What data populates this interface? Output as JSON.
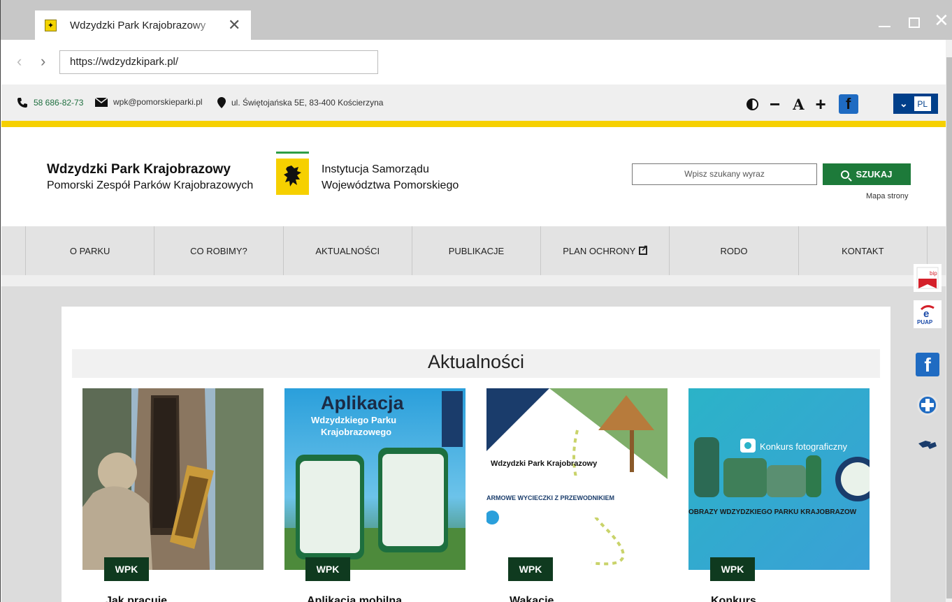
{
  "browser": {
    "tab_title": "Wdzydzki Park Krajobrazowy",
    "url": "https://wdzydzkipark.pl/"
  },
  "contact": {
    "phone": "58 686-82-73",
    "email": "wpk@pomorskieparki.pl",
    "address": "ul. Świętojańska 5E, 83-400 Kościerzyna"
  },
  "accessibility": {
    "font_minus": "−",
    "font_a": "A",
    "font_plus": "+",
    "lang": "PL"
  },
  "header": {
    "park_name": "Wdzydzki Park Krajobrazowy",
    "park_sub": "Pomorski Zespół Parków Krajobrazowych",
    "inst_line1": "Instytucja Samorządu",
    "inst_line2": "Województwa Pomorskiego",
    "search_placeholder": "Wpisz szukany wyraz",
    "search_button": "SZUKAJ",
    "sitemap": "Mapa strony"
  },
  "nav": [
    {
      "label": "O PARKU"
    },
    {
      "label": "CO ROBIMY?"
    },
    {
      "label": "AKTUALNOŚCI"
    },
    {
      "label": "PUBLIKACJE"
    },
    {
      "label": "PLAN OCHRONY"
    },
    {
      "label": "RODO"
    },
    {
      "label": "KONTAKT"
    }
  ],
  "news": {
    "section_title": "Aktualności",
    "items": [
      {
        "badge": "WPK",
        "image": "beekeeper-photo"
      },
      {
        "badge": "WPK",
        "image": "app-poster",
        "poster_title": "Aplikacja",
        "poster_sub1": "Wdzydzkiego Parku",
        "poster_sub2": "Krajobrazowego"
      },
      {
        "badge": "WPK",
        "image": "guided-tours-poster",
        "poster_title": "Wdzydzki Park Krajobrazowy",
        "poster_line": "ARMOWE WYCIECZKI Z PRZEWODNIKIEM"
      },
      {
        "badge": "WPK",
        "image": "photo-contest-poster",
        "poster_title": "Konkurs fotograficzny",
        "poster_line": "OBRAZY WDZYDZKIEGO PARKU KRAJOBRAZOW"
      }
    ]
  },
  "side_links": [
    {
      "label": "bip"
    },
    {
      "label": "ePUAP"
    },
    {
      "label": "f"
    },
    {
      "label": "+"
    },
    {
      "label": "sign"
    }
  ],
  "colors": {
    "accent_green": "#1d7a3a",
    "badge_green": "#0f3a1f",
    "stripe_yellow": "#f6d000",
    "lang_blue": "#003f8a"
  }
}
